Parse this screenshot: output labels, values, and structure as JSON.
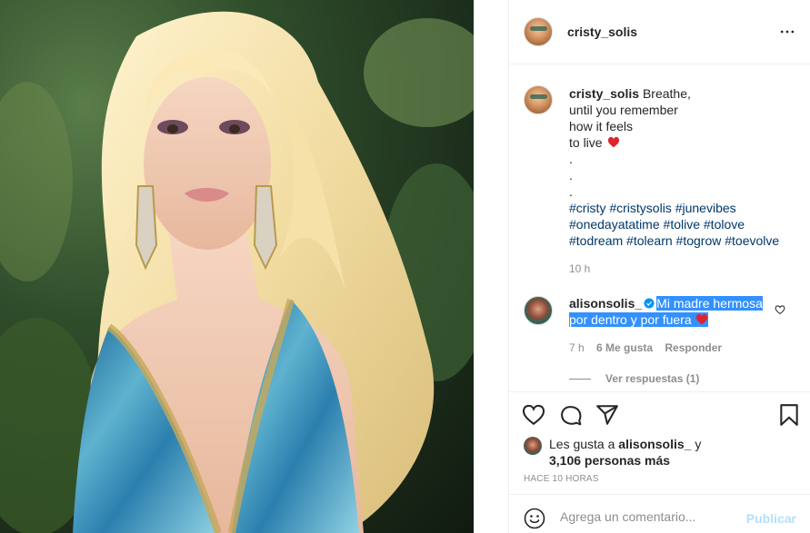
{
  "post": {
    "author": "cristy_solis",
    "caption_lines": [
      "Breathe,",
      "until you remember",
      "how it feels",
      "to live"
    ],
    "dots": [
      ".",
      ".",
      "."
    ],
    "hashtags": [
      "#cristy",
      "#cristysolis",
      "#junevibes",
      "#onedayatatime",
      "#tolive",
      "#tolove",
      "#todream",
      "#tolearn",
      "#togrow",
      "#toevolve"
    ],
    "caption_time": "10 h"
  },
  "comment": {
    "author": "alisonsolis_",
    "text_line1": "Mi madre hermosa",
    "text_line2": "por dentro y por fuera",
    "time": "7 h",
    "likes": "6 Me gusta",
    "reply_label": "Responder",
    "view_replies": "Ver respuestas (1)"
  },
  "likes": {
    "prefix": "Les gusta a",
    "user": "alisonsolis_",
    "connector": "y",
    "count": "3,106 personas más"
  },
  "posted_ago": "HACE 10 HORAS",
  "add_comment": {
    "placeholder": "Agrega un comentario...",
    "publish_label": "Publicar"
  },
  "colors": {
    "link": "#00376b",
    "heart": "#ed4956",
    "selection": "#3390ff",
    "verified": "#0095f6"
  },
  "icons": [
    "more-icon",
    "heart-icon",
    "comment-icon",
    "share-icon",
    "bookmark-icon",
    "verified-icon",
    "emoji-icon"
  ]
}
